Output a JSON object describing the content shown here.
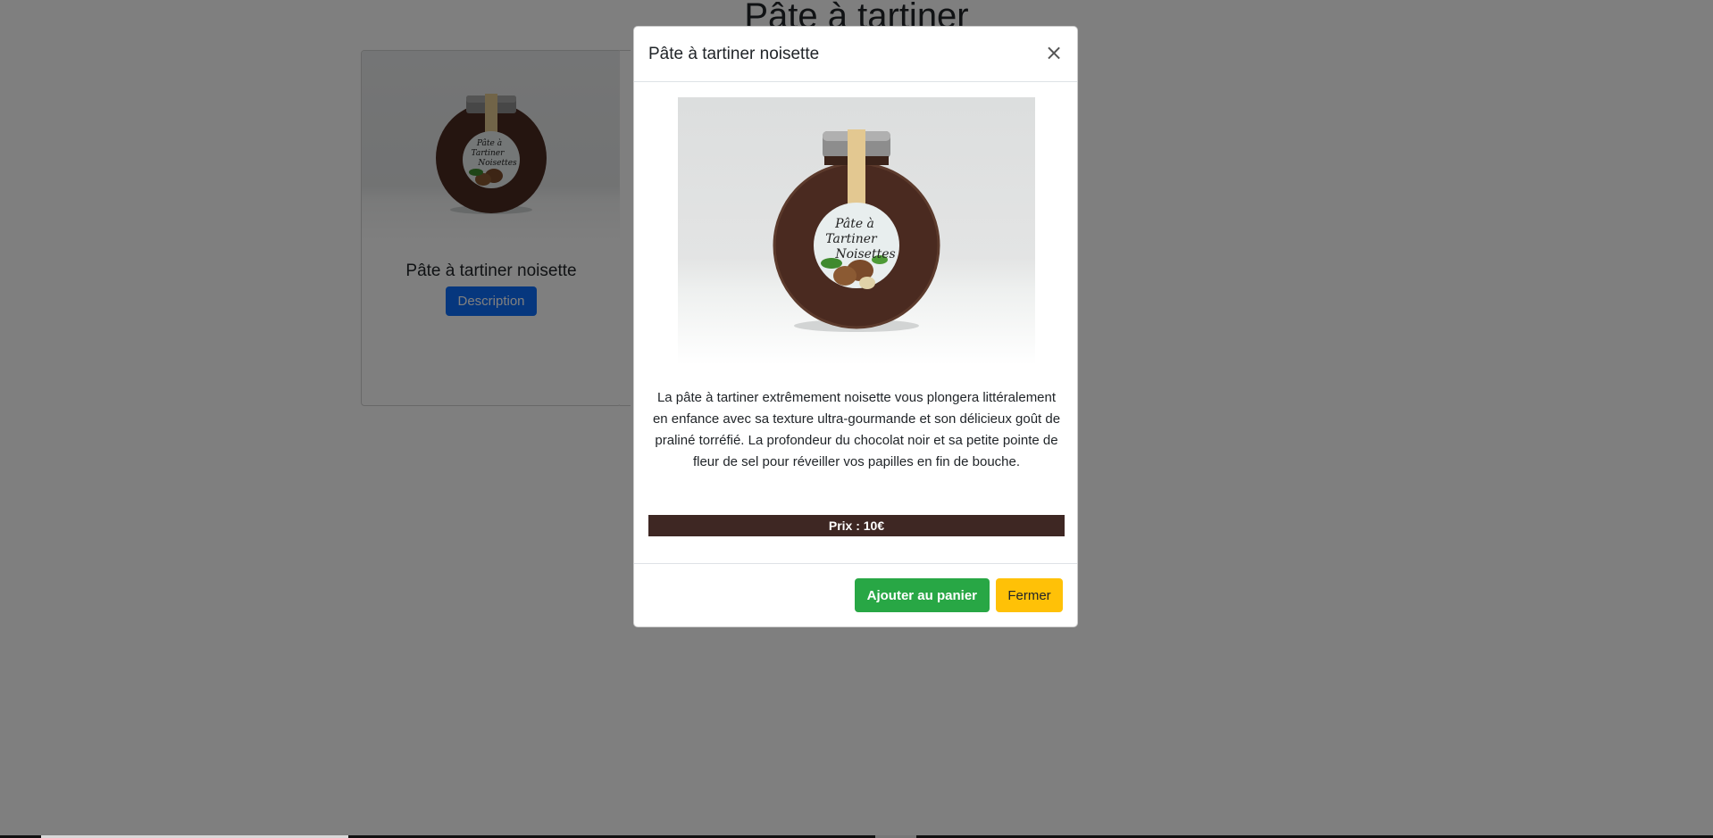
{
  "page": {
    "title": "Pâte à tartiner"
  },
  "product_card": {
    "title": "Pâte à tartiner noisette",
    "description_button": "Description",
    "image_label_line1": "Pâte à",
    "image_label_line2": "Tartiner",
    "image_label_line3": "Noisettes"
  },
  "modal": {
    "title": "Pâte à tartiner noisette",
    "close_label": "×",
    "image_label_line1": "Pâte à",
    "image_label_line2": "Tartiner",
    "image_label_line3": "Noisettes",
    "description": "La pâte à tartiner extrêmement noisette vous plongera littéralement en enfance avec sa texture ultra-gourmande et son délicieux goût de praliné torréfié. La profondeur du chocolat noir et sa petite pointe de fleur de sel pour réveiller vos papilles en fin de bouche.",
    "price": "Prix : 10€",
    "add_to_cart_button": "Ajouter au panier",
    "close_button": "Fermer"
  },
  "colors": {
    "primary": "#0d6efd",
    "success": "#28a745",
    "warning": "#ffc107",
    "price_bar": "#3e2723"
  },
  "icons": {
    "close": "close-icon",
    "jar": "jar-image"
  }
}
